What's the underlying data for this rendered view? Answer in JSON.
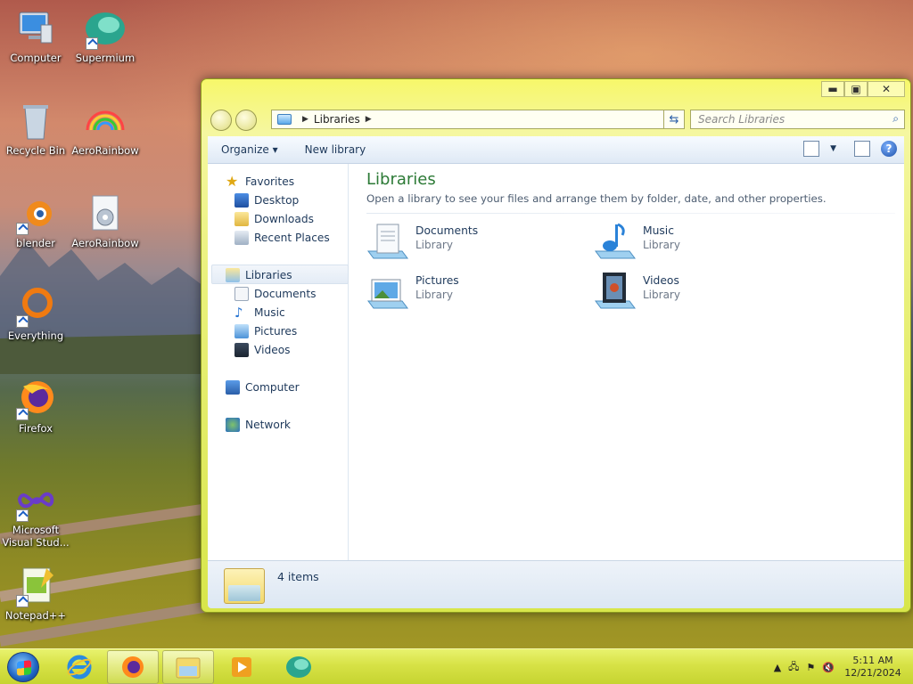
{
  "desktop": {
    "icons": [
      {
        "label": "Computer",
        "icon": "computer-icon"
      },
      {
        "label": "Supermium",
        "icon": "supermium-icon"
      },
      {
        "label": "Recycle Bin",
        "icon": "recycle-bin-icon"
      },
      {
        "label": "AeroRainbow",
        "icon": "aerorainbow-icon"
      },
      {
        "label": "blender",
        "icon": "blender-icon"
      },
      {
        "label": "AeroRainbow",
        "icon": "aerorainbow-settings-icon"
      },
      {
        "label": "Everything",
        "icon": "everything-icon"
      },
      {
        "label": "Firefox",
        "icon": "firefox-icon"
      },
      {
        "label": "Microsoft Visual Stud...",
        "icon": "visual-studio-icon"
      },
      {
        "label": "Notepad++",
        "icon": "notepad-plus-plus-icon"
      }
    ]
  },
  "window": {
    "address": {
      "crumb": "Libraries",
      "dropdown_icon": "chevron-down-icon"
    },
    "search_placeholder": "Search Libraries",
    "toolbar": {
      "organize": "Organize ▾",
      "new_library": "New library"
    },
    "nav": {
      "favorites": "Favorites",
      "desktop": "Desktop",
      "downloads": "Downloads",
      "recent": "Recent Places",
      "libraries": "Libraries",
      "documents": "Documents",
      "music": "Music",
      "pictures": "Pictures",
      "videos": "Videos",
      "computer": "Computer",
      "network": "Network"
    },
    "content": {
      "title": "Libraries",
      "subtitle": "Open a library to see your files and arrange them by folder, date, and other properties.",
      "items": [
        {
          "name": "Documents",
          "type": "Library"
        },
        {
          "name": "Music",
          "type": "Library"
        },
        {
          "name": "Pictures",
          "type": "Library"
        },
        {
          "name": "Videos",
          "type": "Library"
        }
      ]
    },
    "details": {
      "count": "4 items"
    }
  },
  "taskbar": {
    "pinned": [
      "internet-explorer-icon",
      "firefox-icon",
      "explorer-icon",
      "media-player-icon",
      "supermium-icon"
    ],
    "clock_time": "5:11 AM",
    "clock_date": "12/21/2024"
  },
  "colors": {
    "accent_green": "#2c7a36",
    "nav_text": "#1e395b",
    "frame_yellow": "#e9f07a"
  }
}
